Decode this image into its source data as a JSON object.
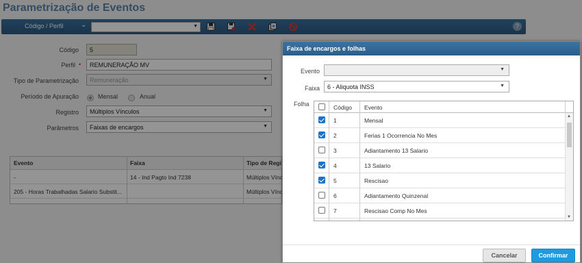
{
  "page": {
    "title": "Parametrização de Eventos"
  },
  "toolbar": {
    "codigo_perfil_label": "Código / Perfil",
    "select_value": "",
    "icons": [
      "save-icon",
      "save-as-icon",
      "delete-icon",
      "copy-icon",
      "block-icon",
      "help-icon"
    ],
    "help_label": "?"
  },
  "form": {
    "codigo": {
      "label": "Código",
      "value": "5"
    },
    "perfil": {
      "label": "Perfil",
      "value": "REMUNERAÇÃO MV",
      "required_mark": "•"
    },
    "tipo": {
      "label": "Tipo de Parametrização",
      "value": "Remuneração"
    },
    "periodo": {
      "label": "Período de Apuração",
      "option1": "Mensal",
      "option2": "Anual",
      "selected": "Mensal"
    },
    "registro": {
      "label": "Registro",
      "value": "Múltiplos Vínculos"
    },
    "parametros": {
      "label": "Parâmetros",
      "value": "Faixas de encargos"
    }
  },
  "grid": {
    "columns": [
      "Evento",
      "Faixa",
      "Tipo de Regi"
    ],
    "rows": [
      {
        "evento": "-",
        "faixa": "14 - Ind Pagto Ind 7238",
        "tipo": "Múltiplos Vínc"
      },
      {
        "evento": "205 - Horas Trabalhadas Salario Substit...",
        "faixa": "",
        "tipo": "Múltiplos Vínc"
      }
    ]
  },
  "modal": {
    "title": "Faixa de encargos e folhas",
    "evento_label": "Evento",
    "evento_value": "",
    "faixa_label": "Faixa",
    "faixa_value": "6 - Aliquota INSS",
    "folha_label": "Folha",
    "list_columns": [
      "Código",
      "Evento"
    ],
    "list_rows": [
      {
        "codigo": "1",
        "evento": "Mensal",
        "checked": true
      },
      {
        "codigo": "2",
        "evento": "Ferias 1 Ocorrencia No Mes",
        "checked": true
      },
      {
        "codigo": "3",
        "evento": "Adiantamento 13 Salario",
        "checked": false
      },
      {
        "codigo": "4",
        "evento": "13 Salario",
        "checked": true
      },
      {
        "codigo": "5",
        "evento": "Rescisao",
        "checked": true
      },
      {
        "codigo": "6",
        "evento": "Adiantamento Quinzenal",
        "checked": false
      },
      {
        "codigo": "7",
        "evento": "Rescisao Comp No Mes",
        "checked": false
      }
    ],
    "cancel_label": "Cancelar",
    "confirm_label": "Confirmar"
  }
}
